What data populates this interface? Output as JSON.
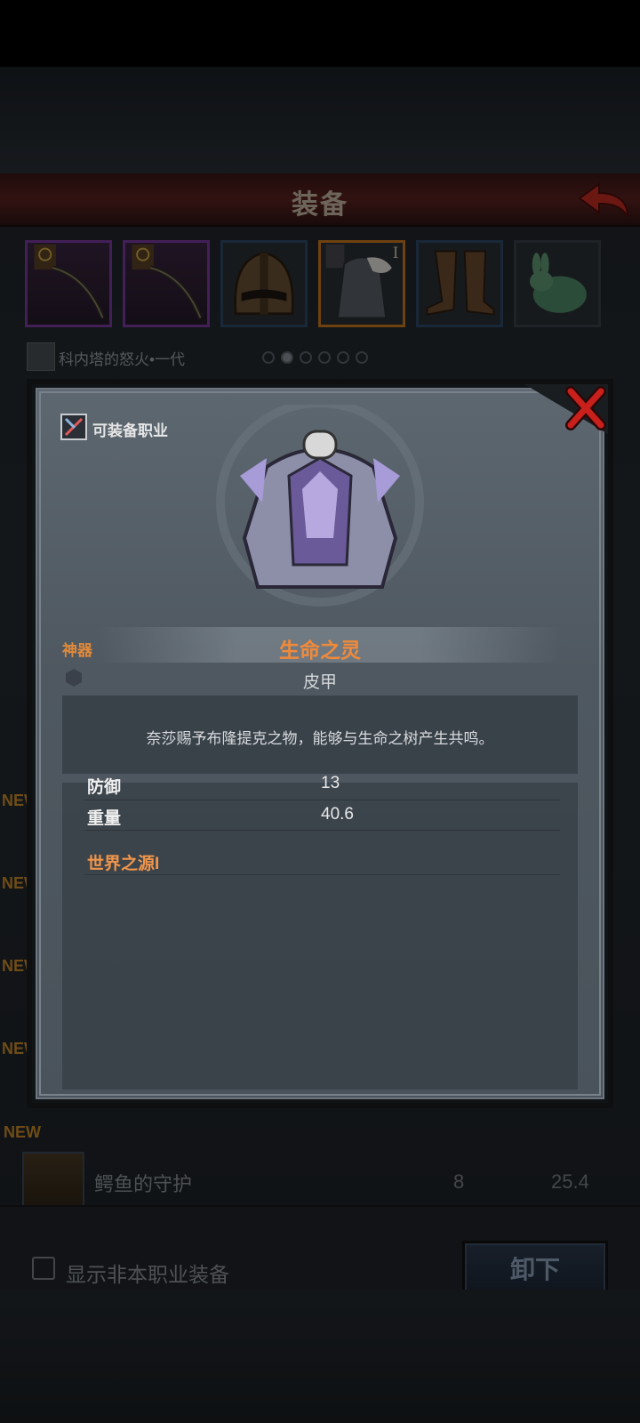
{
  "header": {
    "title": "装备"
  },
  "character": {
    "name": "科内塔的怒火•一代"
  },
  "slots": [
    {
      "icon": "purple-bow-icon"
    },
    {
      "icon": "purple-bow-icon"
    },
    {
      "icon": "helmet-icon"
    },
    {
      "icon": "armor-icon",
      "badge": "I"
    },
    {
      "icon": "boots-icon"
    },
    {
      "icon": "jade-rabbit-icon"
    }
  ],
  "list": {
    "new_tag": "NEW",
    "row": {
      "name": "鳄鱼的守护",
      "defense": "8",
      "weight": "25.4"
    }
  },
  "bottom": {
    "show_other_class_label": "显示非本职业装备",
    "unequip_label": "卸下"
  },
  "modal": {
    "class_label": "可装备职业",
    "rarity": "神器",
    "item_name": "生命之灵",
    "item_type": "皮甲",
    "description": "奈莎赐予布隆提克之物，能够与生命之树产生共鸣。",
    "stats": [
      {
        "name": "防御",
        "value": "13"
      },
      {
        "name": "重量",
        "value": "40.6"
      }
    ],
    "set_name": "世界之源I"
  },
  "colors": {
    "rarity_orange": "#e08a3a",
    "title_bar_red": "#5a2220",
    "close_red": "#c9201c"
  }
}
